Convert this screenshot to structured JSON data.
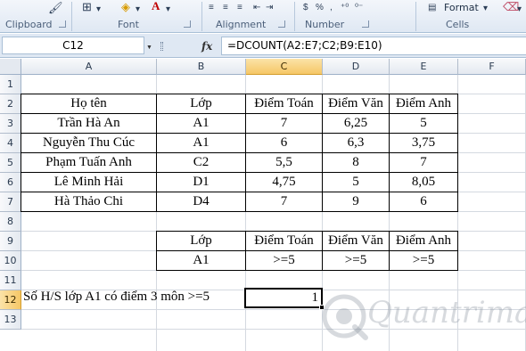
{
  "ribbon": {
    "groups": [
      {
        "label": "Clipboard"
      },
      {
        "label": "Font"
      },
      {
        "label": "Alignment"
      },
      {
        "label": "Number"
      },
      {
        "label": "Cells"
      }
    ],
    "format_label": "Format",
    "icons": [
      "format-painter-icon",
      "borders-icon",
      "fill-color-icon",
      "font-color-icon",
      "align-left-icon",
      "align-center-icon",
      "align-right-icon",
      "indent-icon",
      "currency-icon",
      "percent-icon",
      "comma-style-icon",
      "decrease-decimal-icon",
      "increase-decimal-icon",
      "delete-icon",
      "format-icon",
      "clear-icon"
    ]
  },
  "formula_bar": {
    "name_box": "C12",
    "fx_label": "fx",
    "formula": "=DCOUNT(A2:E7;C2;B9:E10)"
  },
  "columns": [
    "A",
    "B",
    "C",
    "D",
    "E",
    "F"
  ],
  "rows": [
    "1",
    "2",
    "3",
    "4",
    "5",
    "6",
    "7",
    "8",
    "9",
    "10",
    "11",
    "12",
    "13"
  ],
  "selected_column": "C",
  "selected_row": "12",
  "table": {
    "headers": [
      "Họ tên",
      "Lớp",
      "Điểm Toán",
      "Điểm Văn",
      "Điểm Anh"
    ],
    "rows": [
      [
        "Trần Hà An",
        "A1",
        "7",
        "6,25",
        "5"
      ],
      [
        "Nguyễn Thu Cúc",
        "A1",
        "6",
        "6,3",
        "3,75"
      ],
      [
        "Phạm Tuấn Anh",
        "C2",
        "5,5",
        "8",
        "7"
      ],
      [
        "Lê Minh Hải",
        "D1",
        "4,75",
        "5",
        "8,05"
      ],
      [
        "Hà Thảo Chi",
        "D4",
        "7",
        "9",
        "6"
      ]
    ]
  },
  "criteria": {
    "headers": [
      "Lớp",
      "Điểm Toán",
      "Điểm Văn",
      "Điểm Anh"
    ],
    "values": [
      "A1",
      ">=5",
      ">=5",
      ">=5"
    ]
  },
  "result": {
    "label": "Số H/S lớp A1 có điểm 3 môn >=5",
    "value": "1"
  },
  "watermark": "Quantrimang"
}
